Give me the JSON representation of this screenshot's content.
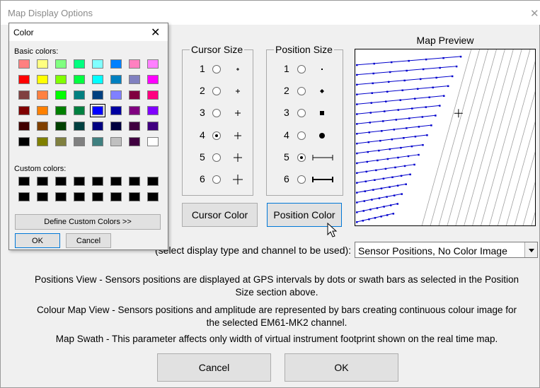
{
  "window": {
    "title": "Map Display Options",
    "close_glyph": "✕"
  },
  "cursor_size": {
    "legend": "Cursor Size",
    "selected": 4,
    "options": [
      {
        "label": "1"
      },
      {
        "label": "2"
      },
      {
        "label": "3"
      },
      {
        "label": "4"
      },
      {
        "label": "5"
      },
      {
        "label": "6"
      }
    ]
  },
  "position_size": {
    "legend": "Position Size",
    "selected": 5,
    "options": [
      {
        "label": "1"
      },
      {
        "label": "2"
      },
      {
        "label": "3"
      },
      {
        "label": "4"
      },
      {
        "label": "5"
      },
      {
        "label": "6"
      }
    ]
  },
  "buttons": {
    "cursor_color": "Cursor Color",
    "position_color": "Position Color",
    "cancel": "Cancel",
    "ok": "OK"
  },
  "map_preview": {
    "label": "Map Preview"
  },
  "display_type": {
    "label": "(select display type and channel to be used):",
    "value": "Sensor Positions, No Color Image"
  },
  "descriptions": {
    "positions_view": "Positions View - Sensors positions are displayed at GPS intervals by dots or swath bars as selected in the Position Size section above.",
    "colour_map_view": "Colour Map View - Sensors positions and amplitude are represented by bars creating continuous colour image for the selected EM61-MK2 channel.",
    "map_swath": "Map Swath - This parameter affects only width of virtual instrument footprint shown on the real time map."
  },
  "color_dialog": {
    "title": "Color",
    "close_glyph": "✕",
    "basic_colors_label": "Basic colors:",
    "custom_colors_label": "Custom colors:",
    "define_button": "Define Custom Colors >>",
    "ok_button": "OK",
    "cancel_button": "Cancel",
    "selected_index": 28,
    "basic_colors": [
      "#ff8080",
      "#ffff80",
      "#80ff80",
      "#00ff80",
      "#80ffff",
      "#0080ff",
      "#ff80c0",
      "#ff80ff",
      "#ff0000",
      "#ffff00",
      "#80ff00",
      "#00ff40",
      "#00ffff",
      "#0080c0",
      "#8080c0",
      "#ff00ff",
      "#804040",
      "#ff8040",
      "#00ff00",
      "#008080",
      "#004080",
      "#8080ff",
      "#800040",
      "#ff0080",
      "#800000",
      "#ff8000",
      "#008000",
      "#008040",
      "#0000ff",
      "#0000a0",
      "#800080",
      "#8000ff",
      "#400000",
      "#804000",
      "#004000",
      "#004040",
      "#000080",
      "#000040",
      "#400040",
      "#400080",
      "#000000",
      "#808000",
      "#808040",
      "#808080",
      "#408080",
      "#c0c0c0",
      "#400040",
      "#ffffff"
    ],
    "custom_colors": [
      "#000000",
      "#000000",
      "#000000",
      "#000000",
      "#000000",
      "#000000",
      "#000000",
      "#000000",
      "#000000",
      "#000000",
      "#000000",
      "#000000",
      "#000000",
      "#000000",
      "#000000",
      "#000000"
    ]
  },
  "colors": {
    "dialog_bg": "#f0f0f0",
    "button_bg": "#e1e1e1",
    "focus_border": "#0078d7",
    "preview_line": "#0000cc"
  }
}
